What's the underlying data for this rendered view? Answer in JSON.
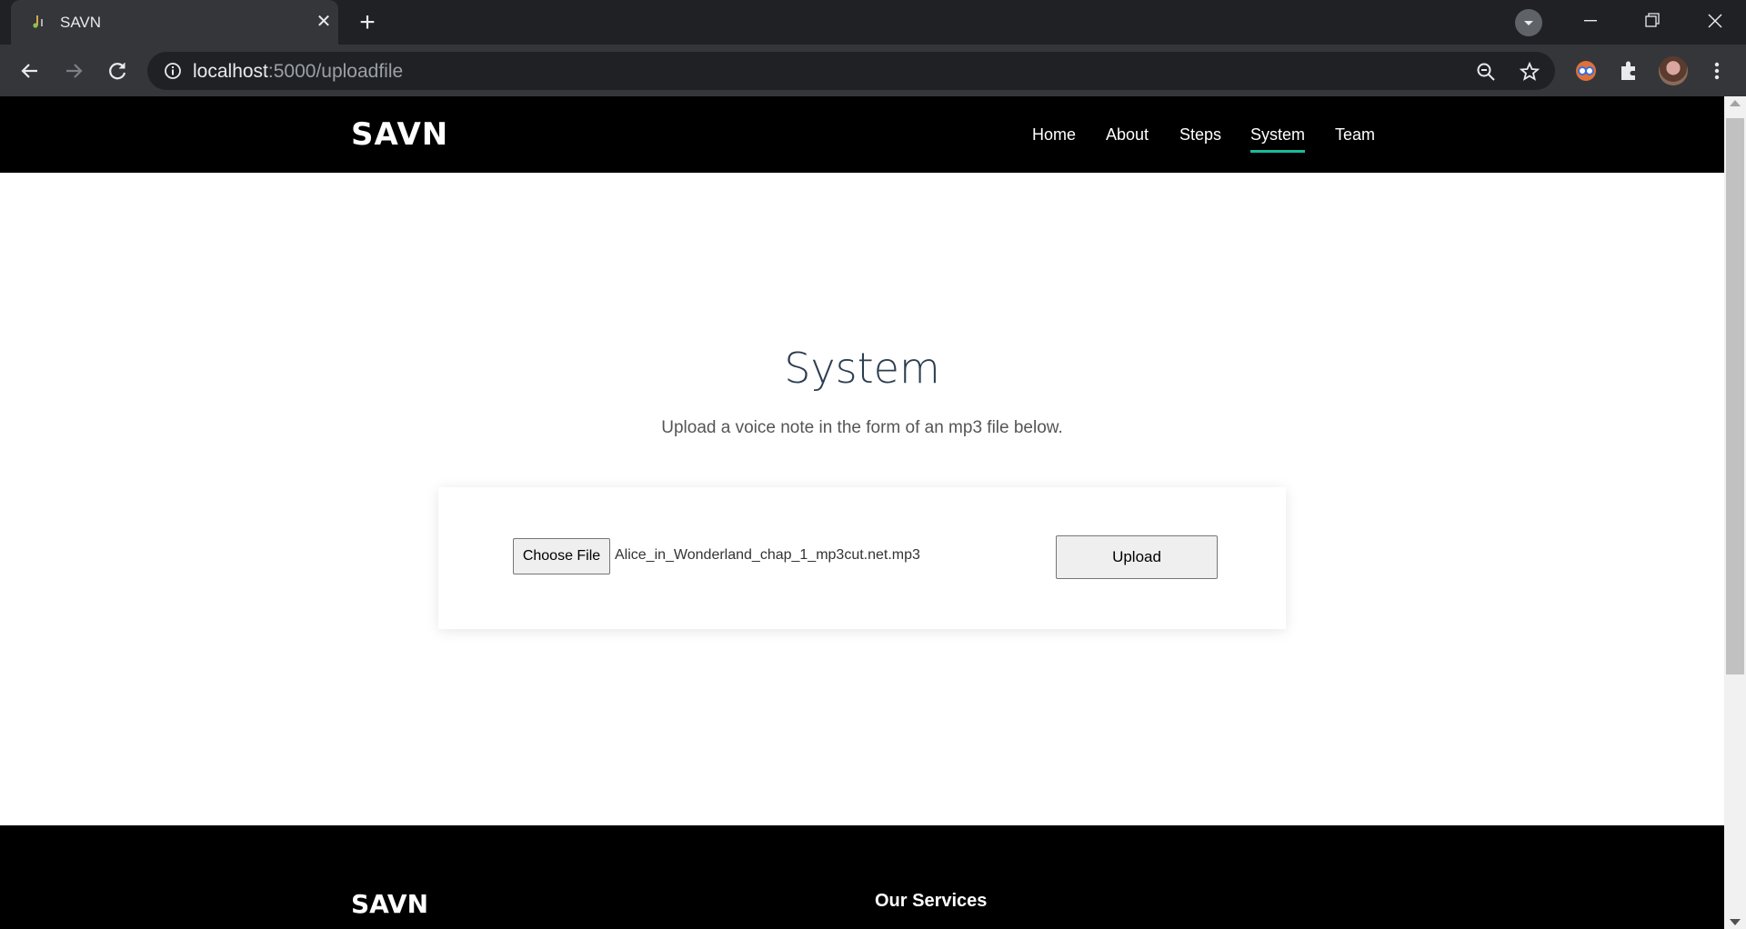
{
  "browser": {
    "tab_title": "SAVN",
    "url_host": "localhost",
    "url_path": ":5000/uploadfile",
    "icons": [
      "music-note-icon",
      "close-icon",
      "plus-icon",
      "back-icon",
      "forward-icon",
      "reload-icon",
      "info-icon",
      "zoom-icon",
      "star-icon",
      "extension-icon",
      "puzzle-icon",
      "menu-icon"
    ]
  },
  "site": {
    "logo": "SAVN",
    "nav": [
      {
        "label": "Home"
      },
      {
        "label": "About"
      },
      {
        "label": "Steps"
      },
      {
        "label": "System",
        "active": true
      },
      {
        "label": "Team"
      }
    ],
    "accent_color": "#1abc9c"
  },
  "main": {
    "title": "System",
    "subtitle": "Upload a voice note in the form of an mp3 file below.",
    "choose_file_label": "Choose File",
    "selected_file": "Alice_in_Wonderland_chap_1_mp3cut.net.mp3",
    "upload_label": "Upload"
  },
  "footer": {
    "logo": "SAVN",
    "services_heading": "Our Services"
  }
}
